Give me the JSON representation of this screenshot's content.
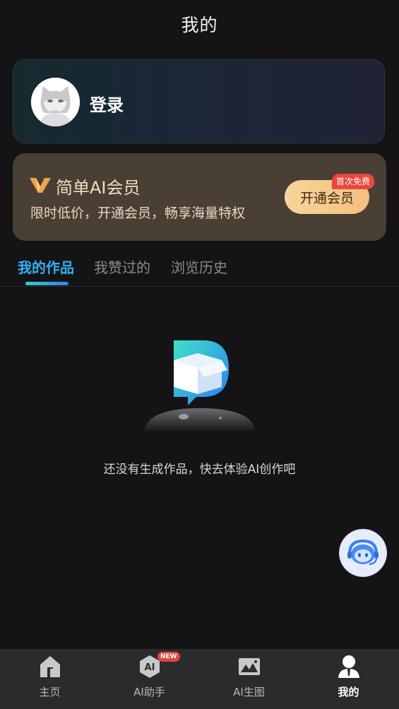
{
  "header": {
    "title": "我的"
  },
  "login_card": {
    "label": "登录"
  },
  "vip_card": {
    "title": "简单AI会员",
    "subtitle": "限时低价，开通会员，畅享海量特权",
    "button_label": "开通会员",
    "badge": "首次免费"
  },
  "tabs": [
    {
      "label": "我的作品",
      "active": true
    },
    {
      "label": "我赞过的",
      "active": false
    },
    {
      "label": "浏览历史",
      "active": false
    }
  ],
  "empty_state": {
    "text": "还没有生成作品，快去体验AI创作吧"
  },
  "bottom_nav": {
    "items": [
      {
        "label": "主页",
        "icon": "home-icon",
        "active": false
      },
      {
        "label": "AI助手",
        "icon": "ai-assistant-icon",
        "active": false,
        "badge": "NEW"
      },
      {
        "label": "AI生图",
        "icon": "image-generate-icon",
        "active": false
      },
      {
        "label": "我的",
        "icon": "profile-icon",
        "active": true
      }
    ]
  },
  "colors": {
    "accent": "#2fb3f2",
    "vip_gold": "#f3c07f",
    "badge_red": "#e8483f",
    "background": "#141416"
  }
}
